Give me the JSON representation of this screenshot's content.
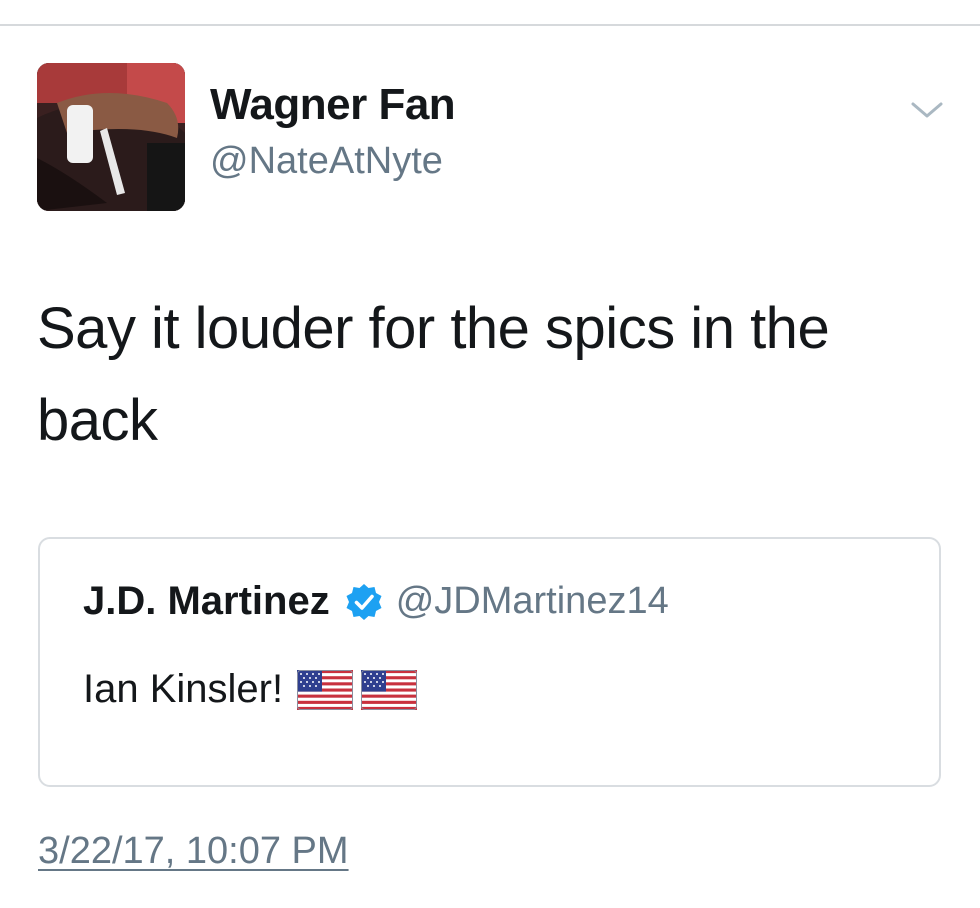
{
  "tweet": {
    "author": {
      "display_name": "Wagner Fan",
      "handle": "@NateAtNyte",
      "avatar_icon": "profile-photo"
    },
    "text": "Say it louder for the spics in the back",
    "timestamp": "3/22/17, 10:07 PM",
    "menu_icon": "chevron-down-icon"
  },
  "quoted_tweet": {
    "display_name": "J.D. Martinez",
    "verified": true,
    "handle": "@JDMartinez14",
    "text": "Ian Kinsler!",
    "emoji": [
      "us-flag-icon",
      "us-flag-icon"
    ]
  },
  "colors": {
    "primary_text": "#14171a",
    "secondary_text": "#657786",
    "verified_blue": "#1da1f2",
    "border": "#d9dde1"
  }
}
